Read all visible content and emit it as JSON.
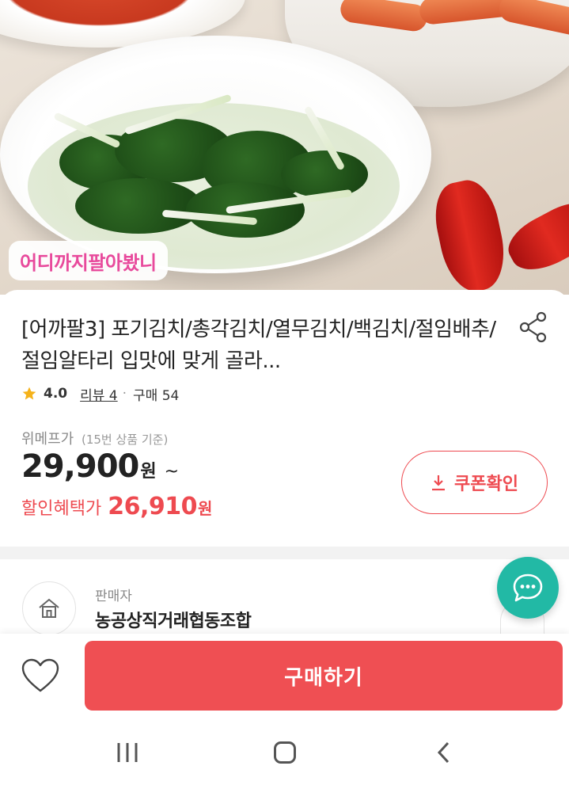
{
  "hero": {
    "brand_badge": "어디까지팔아봤니"
  },
  "product": {
    "title": "[어까팔3] 포기김치/총각김치/열무김치/백김치/절임배추/절임알타리 입맛에 맞게 골라...",
    "rating": "4.0",
    "review_label": "리뷰 4",
    "separator": "·",
    "purchase_label": "구매 54"
  },
  "pricing": {
    "label": "위메프가",
    "label_note": "(15번 상품 기준)",
    "price": "29,900",
    "price_unit": "원",
    "price_suffix": "~",
    "discount_label": "할인혜택가",
    "discount_price": "26,910",
    "discount_unit": "원",
    "coupon_button": "쿠폰확인"
  },
  "seller": {
    "label": "판매자",
    "name": "농공상직거래협동조합"
  },
  "bottom_bar": {
    "buy_button": "구매하기"
  },
  "icons": {
    "share": "share-icon",
    "star": "star-icon",
    "download": "download-icon",
    "home": "home-icon",
    "chat": "chat-bubble-icon",
    "heart": "heart-icon",
    "nav_recent": "recent-apps-icon",
    "nav_home": "nav-home-icon",
    "nav_back": "back-icon"
  },
  "colors": {
    "accent": "#ef4f53",
    "brand_pink": "#e84a9c",
    "chat_teal": "#22b9a5",
    "star": "#f5b21a"
  }
}
